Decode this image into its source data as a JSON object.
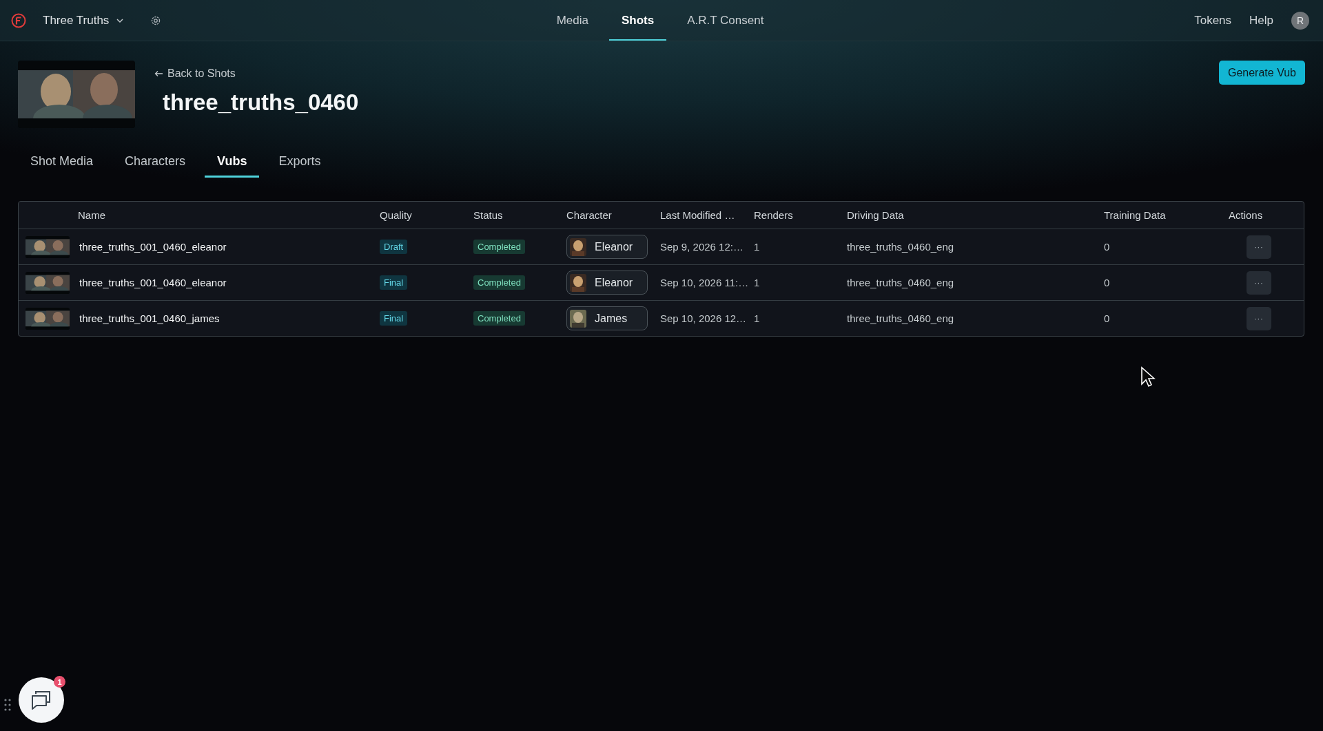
{
  "app": {
    "project": "Three Truths"
  },
  "nav": [
    {
      "label": "Media",
      "selected": false
    },
    {
      "label": "Shots",
      "selected": true
    },
    {
      "label": "A.R.T Consent",
      "selected": false
    }
  ],
  "top_links": [
    "Tokens",
    "Help"
  ],
  "user": {
    "initial": "R"
  },
  "header": {
    "back": "Back to Shots",
    "title": "three_truths_0460",
    "action": "Generate Vub"
  },
  "tabs": [
    {
      "label": "Shot Media",
      "selected": false
    },
    {
      "label": "Characters",
      "selected": false
    },
    {
      "label": "Vubs",
      "selected": true
    },
    {
      "label": "Exports",
      "selected": false
    }
  ],
  "table": {
    "columns": [
      "Name",
      "Quality",
      "Status",
      "Character",
      "Last Modified …",
      "Renders",
      "Driving Data",
      "Training Data",
      "Actions"
    ],
    "rows": [
      {
        "name": "three_truths_001_0460_eleanor",
        "quality": "Draft",
        "status": "Completed",
        "character": "Eleanor",
        "modified": "Sep 9, 2026 12:…",
        "renders": "1",
        "driving": "three_truths_0460_eng",
        "training": "0",
        "actions": "···"
      },
      {
        "name": "three_truths_001_0460_eleanor",
        "quality": "Final",
        "status": "Completed",
        "character": "Eleanor",
        "modified": "Sep 10, 2026 11:…",
        "renders": "1",
        "driving": "three_truths_0460_eng",
        "training": "0",
        "actions": "···"
      },
      {
        "name": "three_truths_001_0460_james",
        "quality": "Final",
        "status": "Completed",
        "character": "James",
        "modified": "Sep 10, 2026 12…",
        "renders": "1",
        "driving": "three_truths_0460_eng",
        "training": "0",
        "actions": "···"
      }
    ]
  },
  "chat": {
    "badge": "1"
  }
}
